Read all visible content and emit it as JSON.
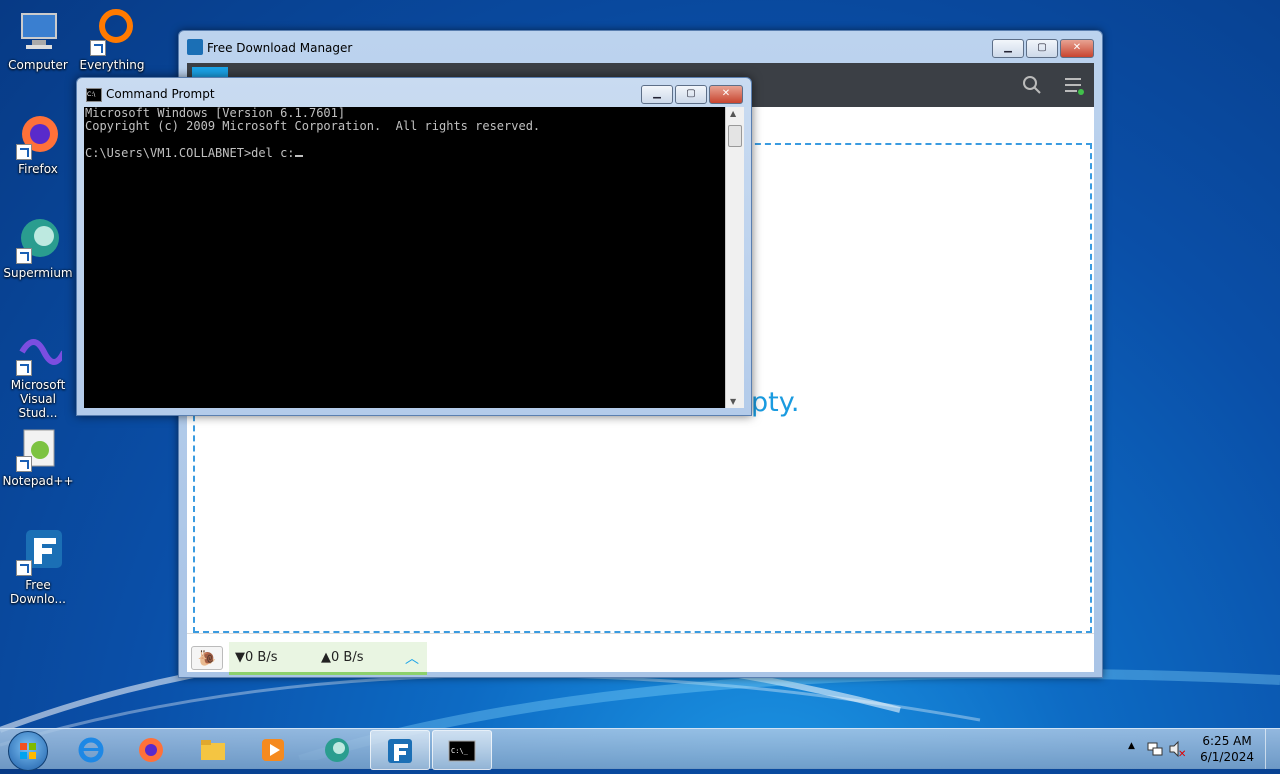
{
  "desktop": {
    "icons": [
      {
        "label": "Computer"
      },
      {
        "label": "Everything"
      },
      {
        "label": "Firefox"
      },
      {
        "label": "Supermium"
      },
      {
        "label": "Microsoft Visual Stud..."
      },
      {
        "label": "Notepad++"
      },
      {
        "label": "Free Downlo..."
      }
    ]
  },
  "fdm": {
    "title": "Free Download Manager",
    "empty_text": "pty.",
    "download_speed": "▼0 B/s",
    "upload_speed": "▲0 B/s",
    "accent_color": "#1aa3e8"
  },
  "cmd": {
    "title": "Command Prompt",
    "lines": [
      "Microsoft Windows [Version 6.1.7601]",
      "Copyright (c) 2009 Microsoft Corporation.  All rights reserved.",
      "",
      "C:\\Users\\VM1.COLLABNET>del c:"
    ]
  },
  "taskbar": {
    "apps": [
      {
        "name": "internet-explorer-icon"
      },
      {
        "name": "firefox-icon"
      },
      {
        "name": "file-explorer-icon"
      },
      {
        "name": "media-player-icon"
      },
      {
        "name": "supermium-icon"
      },
      {
        "name": "free-download-manager-icon"
      },
      {
        "name": "command-prompt-icon"
      }
    ],
    "time": "6:25 AM",
    "date": "6/1/2024"
  }
}
